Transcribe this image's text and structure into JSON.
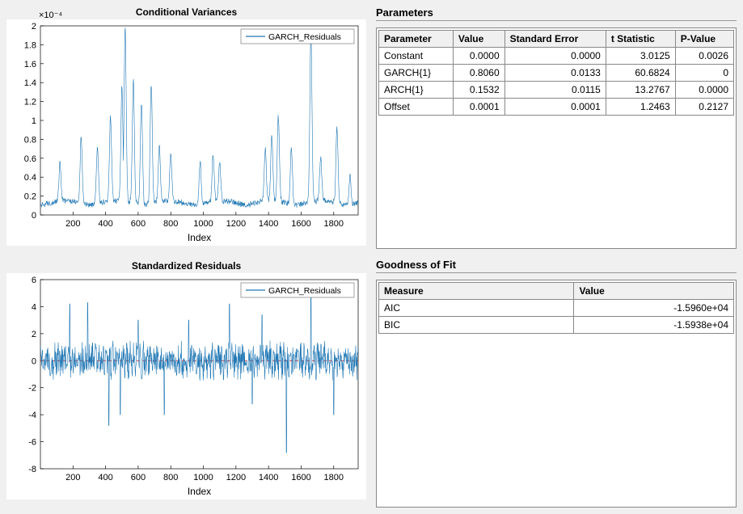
{
  "chart_data": [
    {
      "type": "line",
      "title": "Conditional Variances",
      "xlabel": "Index",
      "ylabel": "",
      "y_exponent_label": "×10⁻⁴",
      "legend": [
        "GARCH_Residuals"
      ],
      "xlim": [
        0,
        1950
      ],
      "ylim": [
        0,
        2
      ],
      "xticks": [
        200,
        400,
        600,
        800,
        1000,
        1200,
        1400,
        1600,
        1800
      ],
      "yticks": [
        0,
        0.2,
        0.4,
        0.6,
        0.8,
        1,
        1.2,
        1.4,
        1.6,
        1.8,
        2
      ],
      "note": "Y values are ×10⁻⁴; series shows volatility clustering with spikes near index 520 (≈1.85), 1660 (≈1.8), typical baseline ≈0.1–0.3"
    },
    {
      "type": "line",
      "title": "Standardized Residuals",
      "xlabel": "Index",
      "ylabel": "",
      "legend": [
        "GARCH_Residuals"
      ],
      "xlim": [
        0,
        1950
      ],
      "ylim": [
        -8,
        6
      ],
      "xticks": [
        200,
        400,
        600,
        800,
        1000,
        1200,
        1400,
        1600,
        1800
      ],
      "yticks": [
        -8,
        -6,
        -4,
        -2,
        0,
        2,
        4,
        6
      ],
      "note": "Noisy residual series centered near 0; range mostly ±2; extreme negative ≈-6.8 near index 1510; red dashed reference line at y=0"
    }
  ],
  "panels": {
    "params_title": "Parameters",
    "gof_title": "Goodness of Fit"
  },
  "params_table": {
    "headers": [
      "Parameter",
      "Value",
      "Standard Error",
      "t Statistic",
      "P-Value"
    ],
    "rows": [
      {
        "param": "Constant",
        "value": "0.0000",
        "se": "0.0000",
        "t": "3.0125",
        "p": "0.0026"
      },
      {
        "param": "GARCH{1}",
        "value": "0.8060",
        "se": "0.0133",
        "t": "60.6824",
        "p": "0"
      },
      {
        "param": "ARCH{1}",
        "value": "0.1532",
        "se": "0.0115",
        "t": "13.2767",
        "p": "0.0000"
      },
      {
        "param": "Offset",
        "value": "0.0001",
        "se": "0.0001",
        "t": "1.2463",
        "p": "0.2127"
      }
    ]
  },
  "gof_table": {
    "headers": [
      "Measure",
      "Value"
    ],
    "rows": [
      {
        "measure": "AIC",
        "value": "-1.5960e+04"
      },
      {
        "measure": "BIC",
        "value": "-1.5938e+04"
      }
    ]
  }
}
